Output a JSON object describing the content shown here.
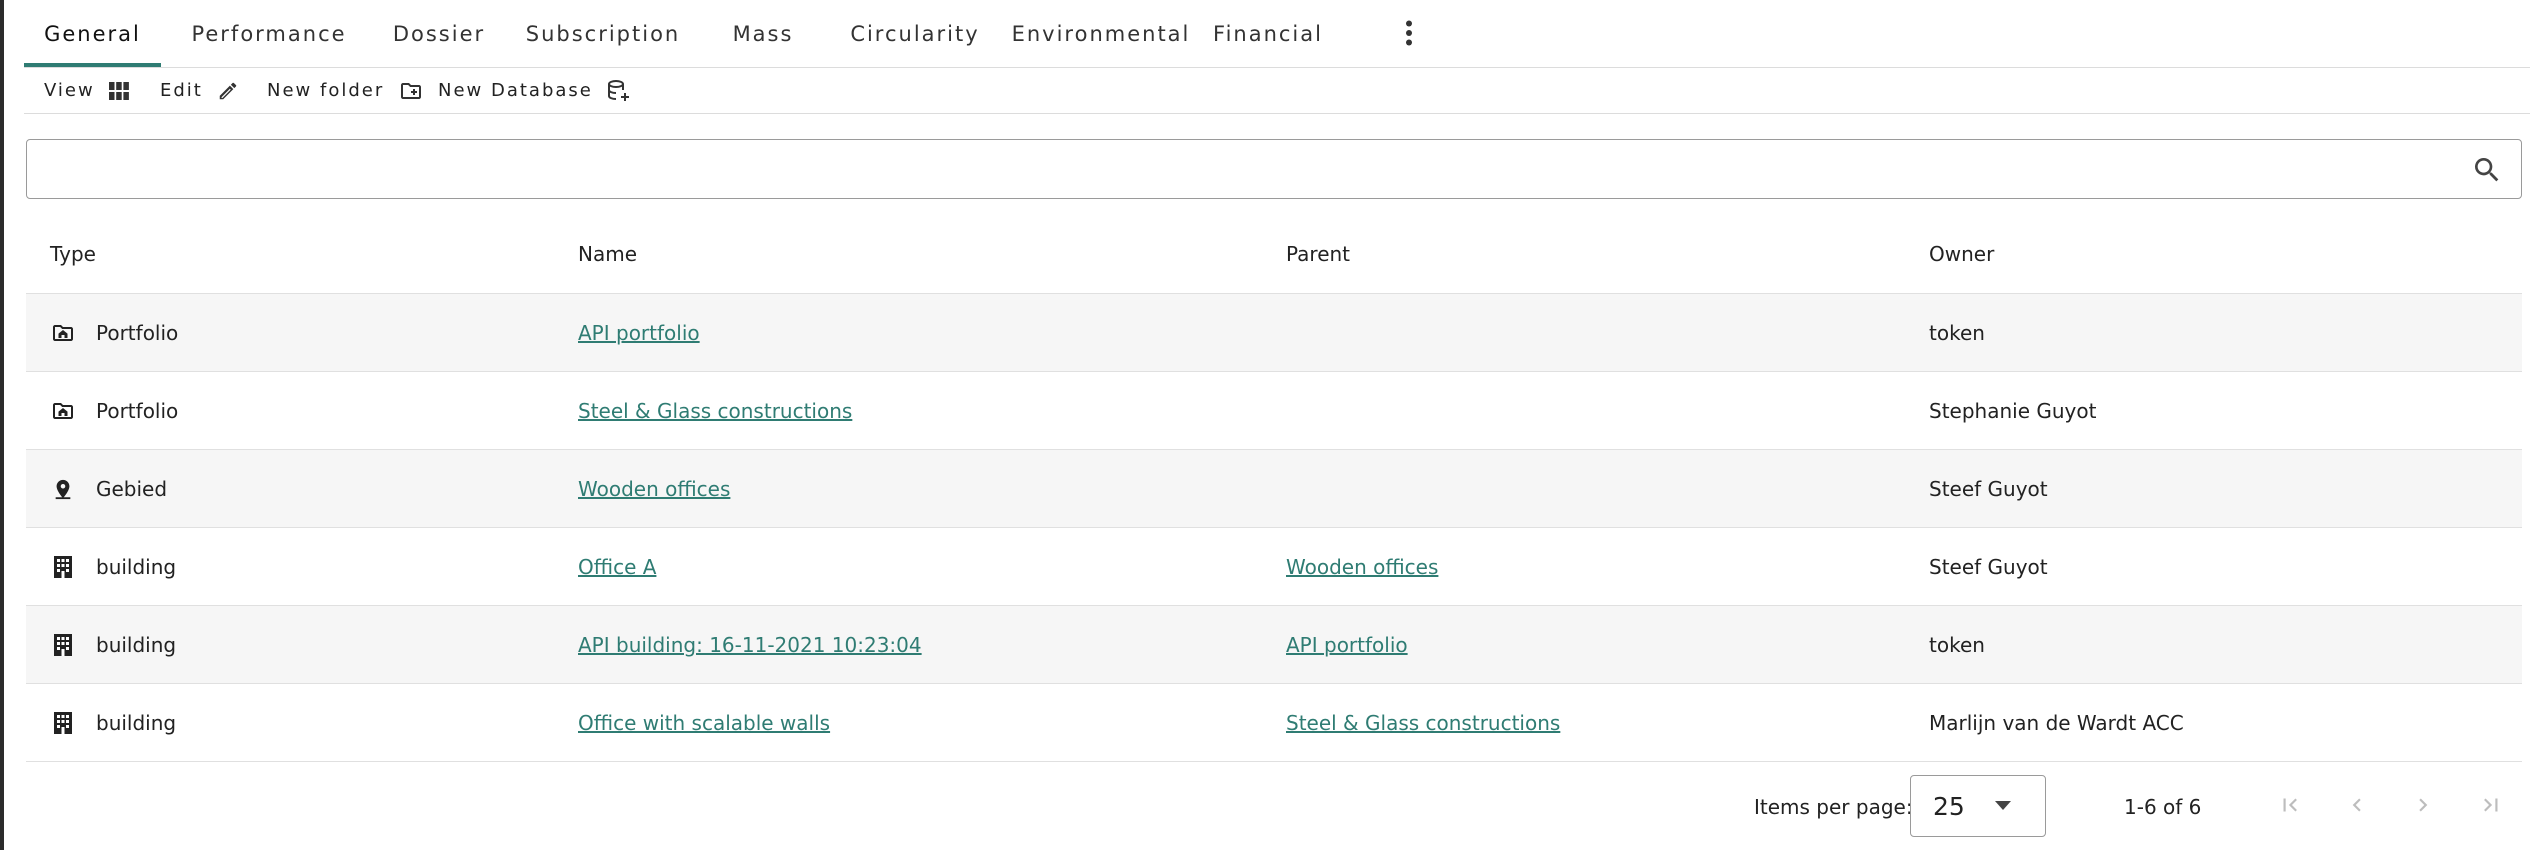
{
  "tabs": [
    {
      "label": "General",
      "active": true
    },
    {
      "label": "Performance",
      "active": false
    },
    {
      "label": "Dossier",
      "active": false
    },
    {
      "label": "Subscription",
      "active": false
    },
    {
      "label": "Mass",
      "active": false
    },
    {
      "label": "Circularity",
      "active": false
    },
    {
      "label": "Environmental",
      "active": false
    },
    {
      "label": "Financial",
      "active": false
    }
  ],
  "more_menu_icon": "more-vert-icon",
  "toolbar": {
    "view_label": "View",
    "view_icon": "grid-view-icon",
    "edit_label": "Edit",
    "edit_icon": "pencil-icon",
    "new_folder_label": "New folder",
    "new_folder_icon": "create-new-folder-icon",
    "new_database_label": "New Database",
    "new_database_icon": "database-add-icon"
  },
  "search": {
    "value": "",
    "placeholder": "",
    "icon": "search-icon"
  },
  "table": {
    "headers": {
      "type": "Type",
      "name": "Name",
      "parent": "Parent",
      "owner": "Owner"
    },
    "rows": [
      {
        "type": "Portfolio",
        "type_icon": "folder-home-icon",
        "name": "API portfolio",
        "parent": "",
        "owner": "token"
      },
      {
        "type": "Portfolio",
        "type_icon": "folder-home-icon",
        "name": "Steel & Glass constructions",
        "parent": "",
        "owner": "Stephanie Guyot"
      },
      {
        "type": "Gebied",
        "type_icon": "location-pin-icon",
        "name": "Wooden offices",
        "parent": "",
        "owner": "Steef Guyot"
      },
      {
        "type": "building",
        "type_icon": "building-icon",
        "name": "Office A",
        "parent": "Wooden offices",
        "owner": "Steef Guyot"
      },
      {
        "type": "building",
        "type_icon": "building-icon",
        "name": "API building: 16-11-2021 10:23:04",
        "parent": "API portfolio",
        "owner": "token"
      },
      {
        "type": "building",
        "type_icon": "building-icon",
        "name": "Office with scalable walls",
        "parent": "Steel & Glass constructions",
        "owner": "Marlijn van de Wardt ACC"
      }
    ]
  },
  "paginator": {
    "items_per_page_label": "Items per page:",
    "items_per_page_value": "25",
    "range_label": "1-6 of 6",
    "first_icon": "first-page-icon",
    "prev_icon": "chevron-left-icon",
    "next_icon": "chevron-right-icon",
    "last_icon": "last-page-icon"
  },
  "colors": {
    "accent": "#2f7c73",
    "row_alt": "#f6f6f6",
    "border": "#dcdcdc"
  }
}
